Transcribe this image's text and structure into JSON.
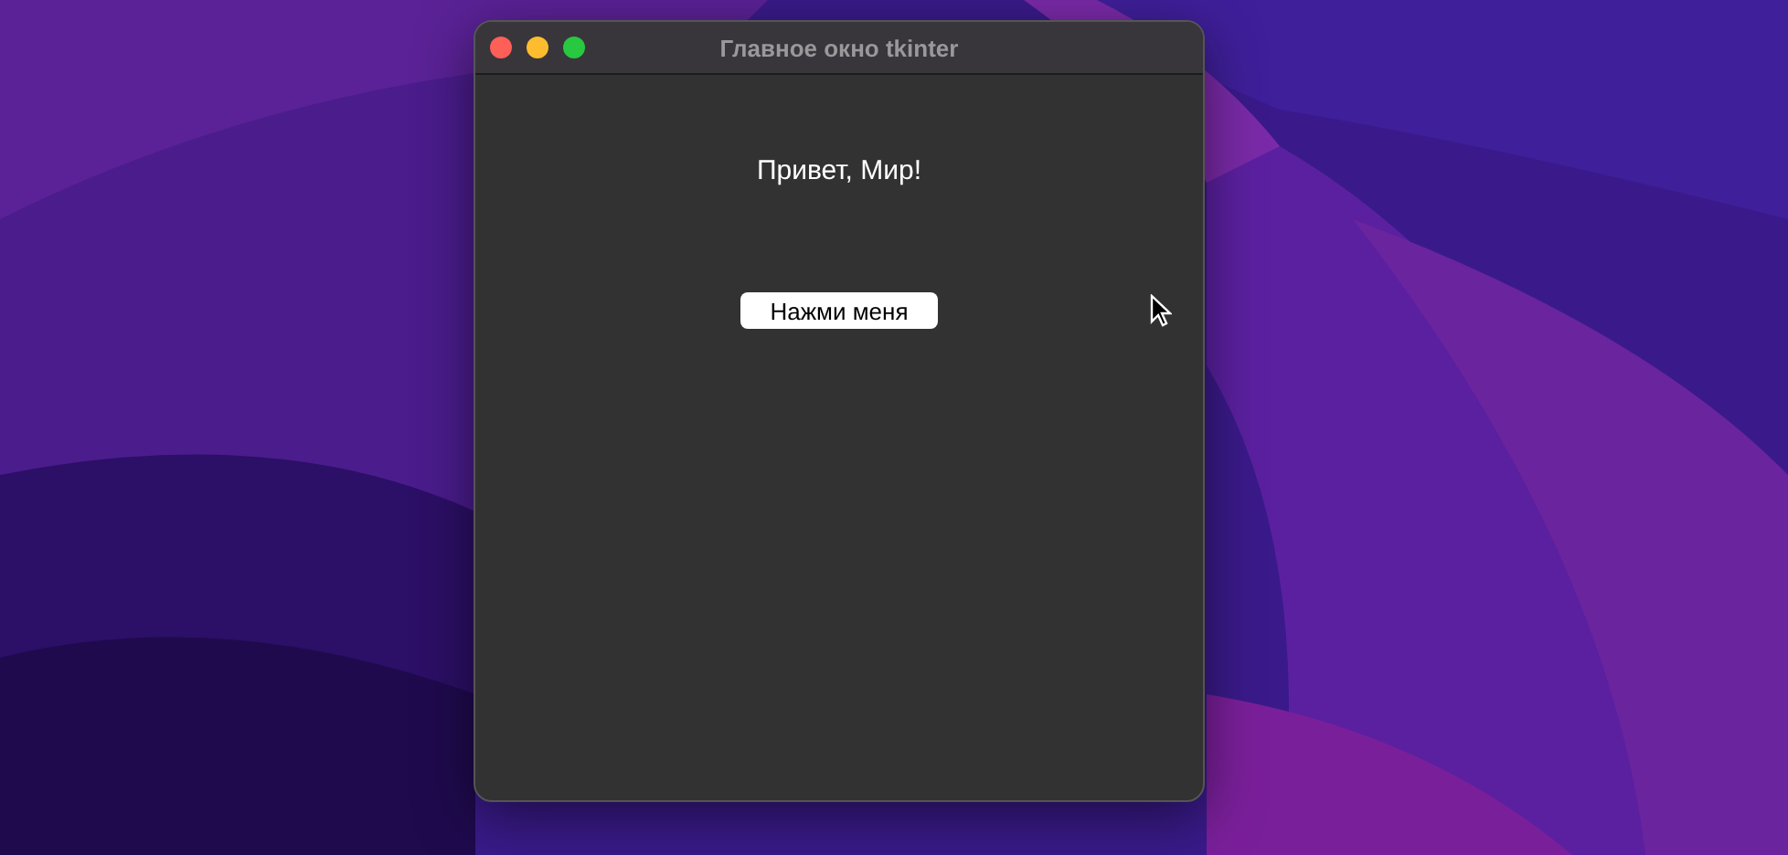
{
  "window": {
    "title": "Главное окно tkinter"
  },
  "label": {
    "text": "Привет, Мир!"
  },
  "button": {
    "label": "Нажми меня"
  }
}
